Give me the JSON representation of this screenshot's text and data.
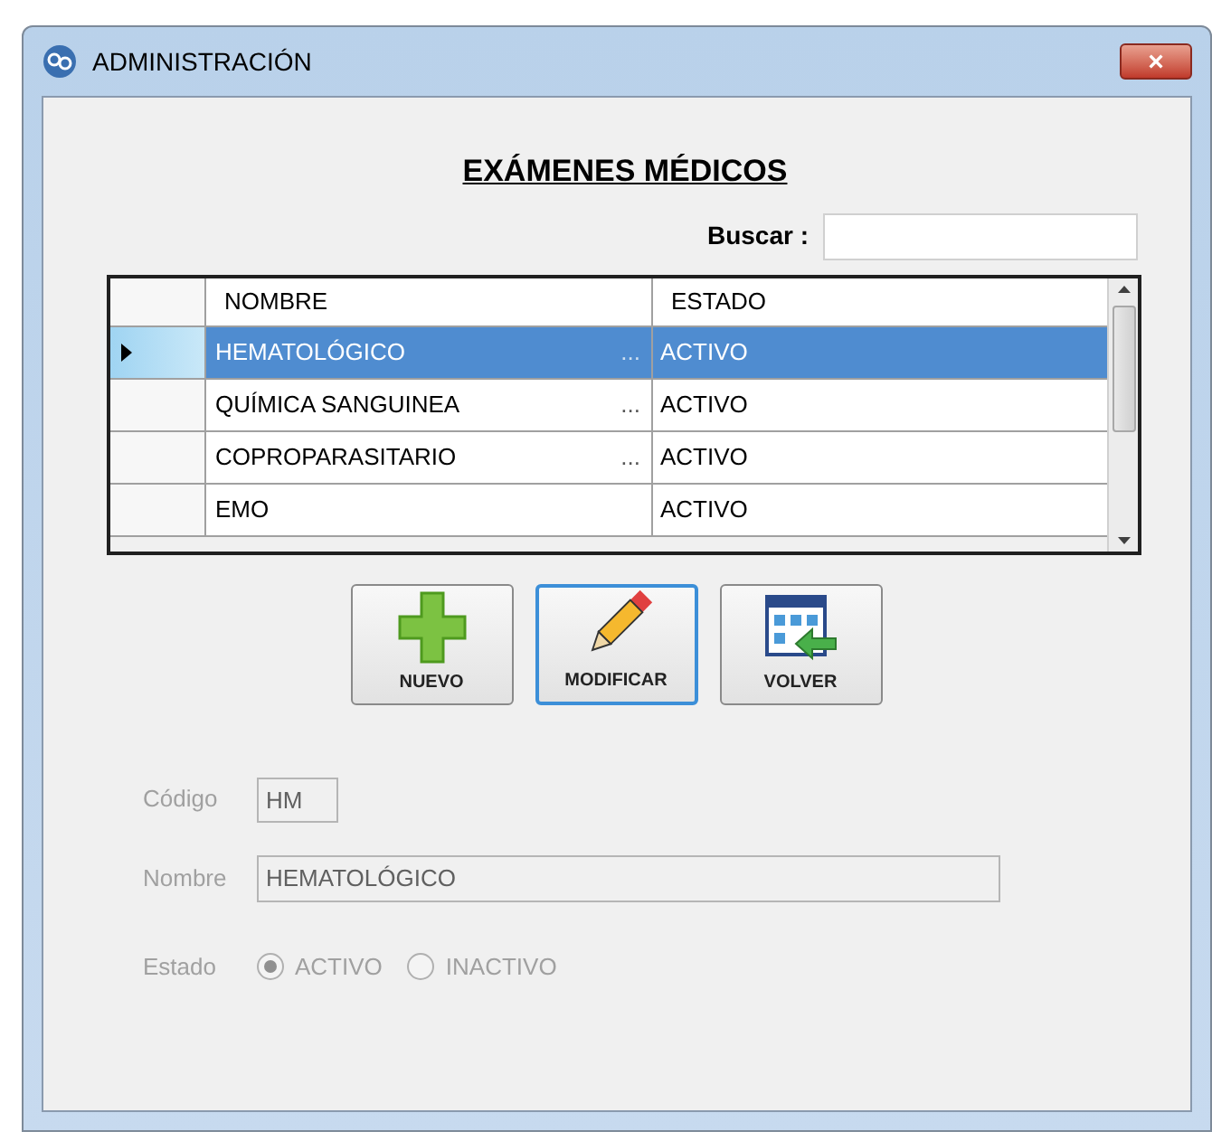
{
  "window": {
    "title": "ADMINISTRACIÓN",
    "close": "×"
  },
  "heading": "EXÁMENES MÉDICOS",
  "search": {
    "label": "Buscar :"
  },
  "table": {
    "columns": [
      "NOMBRE",
      "ESTADO"
    ],
    "rows": [
      {
        "nombre": "HEMATOLÓGICO",
        "more": "...",
        "estado": "ACTIVO",
        "selected": true
      },
      {
        "nombre": "QUÍMICA SANGUINEA",
        "more": "...",
        "estado": "ACTIVO",
        "selected": false
      },
      {
        "nombre": "COPROPARASITARIO",
        "more": "...",
        "estado": "ACTIVO",
        "selected": false
      },
      {
        "nombre": "EMO",
        "estado": "ACTIVO",
        "selected": false
      }
    ]
  },
  "buttons": [
    {
      "kind": "add",
      "label": "NUEVO",
      "focused": false
    },
    {
      "kind": "edit",
      "label": "MODIFICAR",
      "focused": true
    },
    {
      "kind": "back",
      "label": "VOLVER",
      "focused": false
    }
  ],
  "form": {
    "disabled": true,
    "codigo": {
      "label": "Código",
      "value": "HM"
    },
    "nombre": {
      "label": "Nombre",
      "value": "HEMATOLÓGICO"
    },
    "estado": {
      "label": "Estado",
      "options": [
        {
          "label": "ACTIVO",
          "selected": true
        },
        {
          "label": "INACTIVO",
          "selected": false
        }
      ]
    }
  }
}
